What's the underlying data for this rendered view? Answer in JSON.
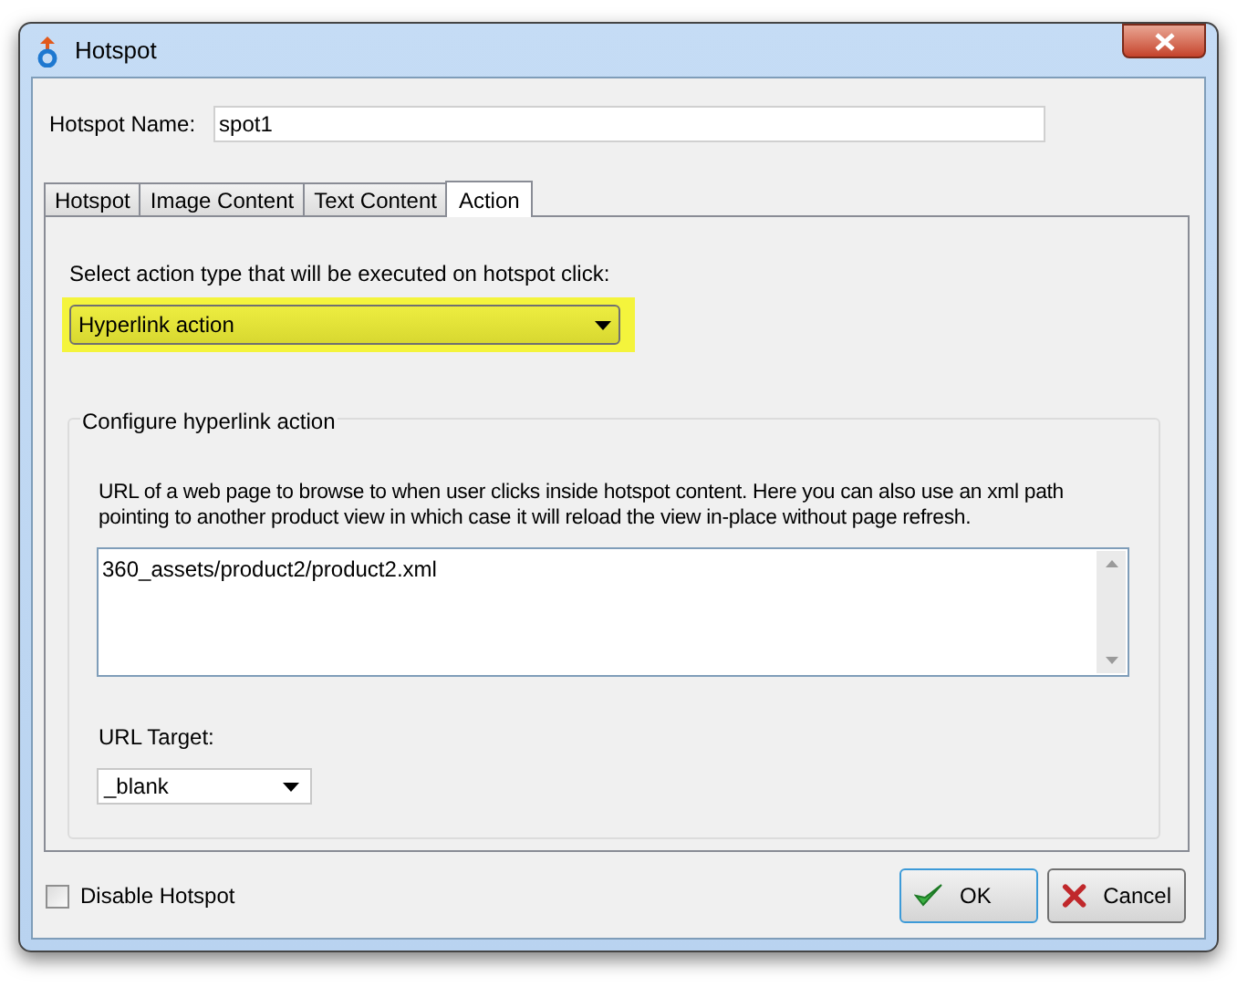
{
  "window": {
    "title": "Hotspot"
  },
  "name_field": {
    "label": "Hotspot Name:",
    "value": "spot1"
  },
  "tabs": [
    {
      "label": "Hotspot",
      "selected": false
    },
    {
      "label": "Image Content",
      "selected": false
    },
    {
      "label": "Text Content",
      "selected": false
    },
    {
      "label": "Action",
      "selected": true
    }
  ],
  "action_type": {
    "label": "Select action type that will be executed on hotspot click:",
    "value": "Hyperlink action",
    "highlighted": true
  },
  "group": {
    "title": "Configure hyperlink action",
    "description": "URL of a web page to browse to when user clicks inside hotspot content. Here you can also use an xml path pointing to another product view in which case it will reload the view in-place without page refresh.",
    "url_value": "360_assets/product2/product2.xml",
    "target_label": "URL Target:",
    "target_value": "_blank"
  },
  "disable_checkbox": {
    "label": "Disable Hotspot",
    "checked": false
  },
  "buttons": [
    {
      "label": "OK",
      "kind": "ok",
      "focused": true
    },
    {
      "label": "Cancel",
      "kind": "cancel",
      "focused": false
    }
  ]
}
